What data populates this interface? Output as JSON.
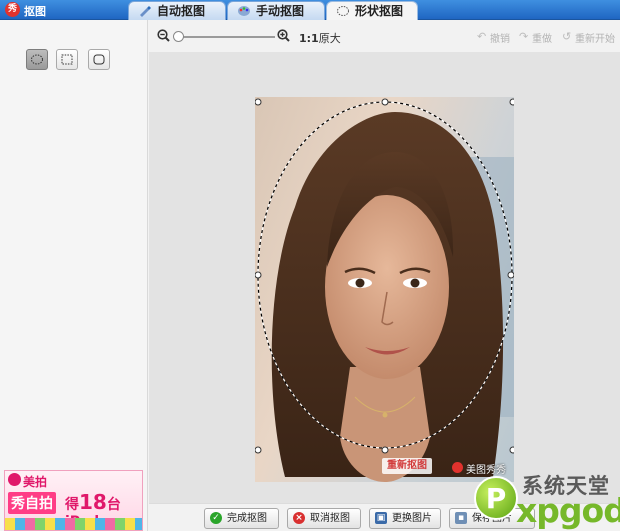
{
  "app": {
    "logo_char": "秀",
    "title": "抠图"
  },
  "tabs": [
    {
      "label": "自动抠图",
      "icon": "brush-icon"
    },
    {
      "label": "手动抠图",
      "icon": "palette-icon"
    },
    {
      "label": "形状抠图",
      "icon": "shape-select-icon",
      "active": true
    }
  ],
  "shape_tools": [
    {
      "name": "ellipse-select",
      "selected": true
    },
    {
      "name": "rect-select",
      "selected": false
    },
    {
      "name": "rounded-rect-select",
      "selected": false
    }
  ],
  "toolbar": {
    "ratio_bold": "1:1",
    "ratio_text": "原大",
    "zoom_level": 0,
    "undo": "撤销",
    "redo": "重做",
    "restart": "重新开始"
  },
  "canvas": {
    "redo_cut": "重新抠图",
    "watermark": "美图秀秀"
  },
  "buttons": {
    "finish": "完成抠图",
    "cancel": "取消抠图",
    "replace": "更换图片",
    "save": "保存图片"
  },
  "ad": {
    "brand": "美拍",
    "main": "秀自拍",
    "prize_pre": "得",
    "prize_num": "18",
    "prize_post": "台iPad"
  },
  "site_logo": {
    "cn": "系统天堂",
    "en": "xpgod"
  },
  "colors": {
    "accent_blue": "#1f66c2",
    "finish_green": "#2aa52a",
    "cancel_red": "#d93030",
    "brand_pink": "#e0186a",
    "site_green": "#76b82a"
  }
}
